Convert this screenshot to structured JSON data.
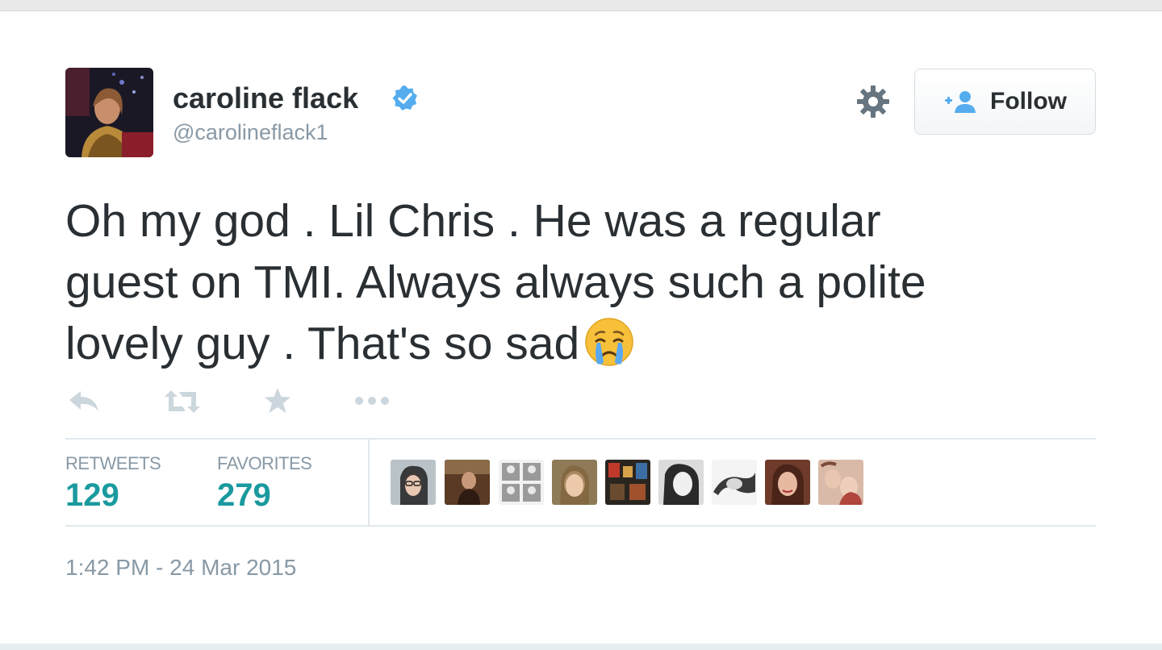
{
  "author": {
    "name": "caroline flack",
    "handle": "@carolineflack1",
    "verified": true,
    "avatar": "profile-photo"
  },
  "follow_button": {
    "label": "Follow",
    "icon": "add-user-icon"
  },
  "settings": {
    "icon": "gear-icon"
  },
  "tweet": {
    "lines": [
      "Oh my god . Lil Chris . He was a regular",
      "guest on TMI. Always always such a polite",
      "lovely guy . That's so sad"
    ],
    "emoji": "crying-face-emoji"
  },
  "actions": [
    "reply-icon",
    "retweet-icon",
    "favorite-icon",
    "more-icon"
  ],
  "stats": {
    "retweets_label": "RETWEETS",
    "retweets_count": "129",
    "favorites_label": "FAVORITES",
    "favorites_count": "279"
  },
  "favorited_by_count": 9,
  "timestamp": "1:42 PM - 24 Mar 2015",
  "colors": {
    "text": "#292f33",
    "muted": "#8899a6",
    "stat_value": "#1a9a9f",
    "verified": "#55acee",
    "follow_icon": "#55acee"
  }
}
